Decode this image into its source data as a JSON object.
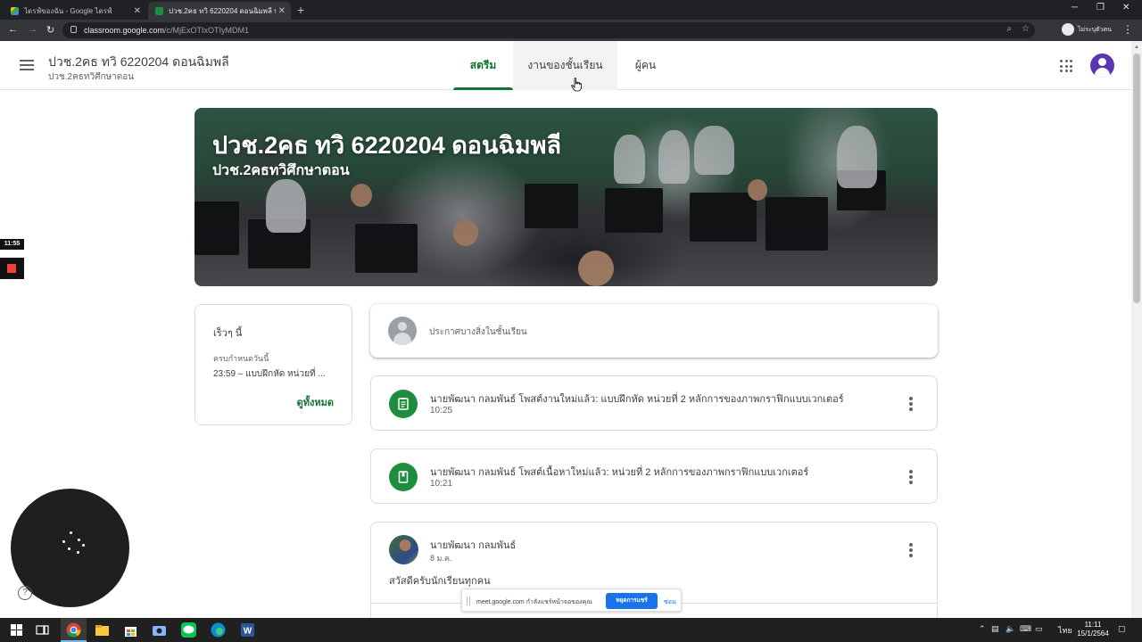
{
  "browser": {
    "tabs": [
      {
        "title": "ไดรฟ์ของฉัน - Google ไดรฟ์",
        "active": false
      },
      {
        "title": "ปวช.2คธ ทวิ 6220204 ดอนฉิมพลี ปว",
        "active": true
      }
    ],
    "url_host": "classroom.google.com",
    "url_path": "/c/MjExOTIxOTIyMDM1",
    "profile_label": "ไม่ระบุตัวตน"
  },
  "header": {
    "class_title": "ปวช.2คธ ทวิ 6220204 ดอนฉิมพลี",
    "class_subtitle": "ปวช.2คธทวิศึกษาตอน",
    "tabs": [
      {
        "label": "สตรีม",
        "active": true
      },
      {
        "label": "งานของชั้นเรียน",
        "active": false
      },
      {
        "label": "ผู้คน",
        "active": false
      }
    ]
  },
  "banner": {
    "title": "ปวช.2คธ ทวิ 6220204 ดอนฉิมพลี",
    "subtitle": "ปวช.2คธทวิศึกษาตอน"
  },
  "upcoming": {
    "heading": "เร็วๆ นี้",
    "due_label": "ครบกำหนดวันนี้",
    "item": "23:59 – แบบฝึกหัด หน่วยที่ ...",
    "view_all": "ดูทั้งหมด"
  },
  "announce": {
    "placeholder": "ประกาศบางสิ่งในชั้นเรียน"
  },
  "stream": [
    {
      "icon": "assignment-icon",
      "title": "นายพัฒนา กลมพันธ์ โพสต์งานใหม่แล้ว: แบบฝึกหัด หน่วยที่ 2 หลักการของภาพกราฟิกแบบเวกเตอร์",
      "time": "10:25"
    },
    {
      "icon": "material-icon",
      "title": "นายพัฒนา กลมพันธ์ โพสต์เนื้อหาใหม่แล้ว: หน่วยที่ 2 หลักการของภาพกราฟิกแบบเวกเตอร์",
      "time": "10:21"
    }
  ],
  "announcement_post": {
    "author": "นายพัฒนา กลมพันธ์",
    "date": "8 ม.ค.",
    "body": "สวัสดีครับนักเรียนทุกคน"
  },
  "overlays": {
    "recording_time": "11:55",
    "meet_share_message": "meet.google.com กำลังแชร์หน้าจอของคุณ",
    "meet_stop_button": "หยุดการแชร์",
    "meet_hide_button": "ซ่อน"
  },
  "taskbar": {
    "time": "11:11",
    "date": "15/1/2564",
    "language": "ไทย"
  },
  "colors": {
    "accent_green": "#137333",
    "icon_green": "#1e8e3e",
    "avatar_purple": "#5c35b0",
    "meet_blue": "#1a73e8"
  }
}
